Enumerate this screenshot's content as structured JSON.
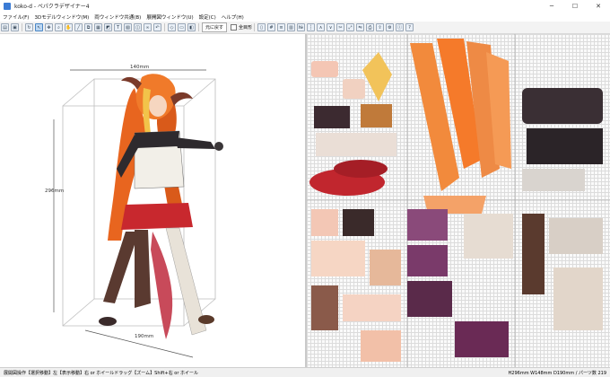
{
  "window": {
    "title": "koko-d - ペパクラデザイナー4",
    "minimize": "─",
    "maximize": "☐",
    "close": "✕"
  },
  "menu": [
    {
      "label": "ファイル(F)"
    },
    {
      "label": "3Dモデルウィンドウ(M)"
    },
    {
      "label": "両ウィンドウ共通(B)"
    },
    {
      "label": "展開図ウィンドウ(U)"
    },
    {
      "label": "設定(C)"
    },
    {
      "label": "ヘルプ(H)"
    }
  ],
  "toolbar": {
    "origin_button_label": "元に戻す",
    "all_parts_checkbox_label": "全目形"
  },
  "viewport": {
    "dim_width": "140mm",
    "dim_height": "296mm",
    "dim_depth": "190mm"
  },
  "status": {
    "left": "展開図操作【選択移動】左【表示移動】右 or ホイールドラッグ【ズーム】Shift+右 or ホイール",
    "right": "H296mm W148mm D190mm / パーツ数 219"
  },
  "colors": {
    "accent": "#3a7bd5",
    "paper_grid": "#dcdcdc"
  }
}
